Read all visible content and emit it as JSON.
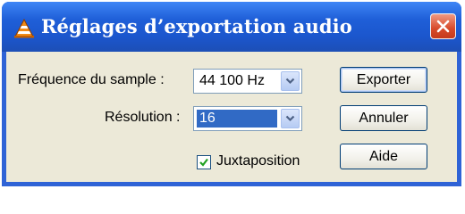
{
  "window": {
    "title": "Réglages d’exportation audio",
    "title_icon": "vlc-cone-icon",
    "close_icon": "close-icon"
  },
  "form": {
    "sample_rate": {
      "label": "Fréquence du sample :",
      "value": "44 100 Hz"
    },
    "resolution": {
      "label": "Résolution :",
      "value": "16"
    },
    "juxtaposition": {
      "label": "Juxtaposition",
      "checked": true
    }
  },
  "buttons": {
    "export": "Exporter",
    "cancel": "Annuler",
    "help": "Aide"
  },
  "colors": {
    "titlebar": "#1f5fd8",
    "close": "#d74a2a",
    "dialog_bg": "#ece9d8",
    "selection": "#316ac5"
  }
}
